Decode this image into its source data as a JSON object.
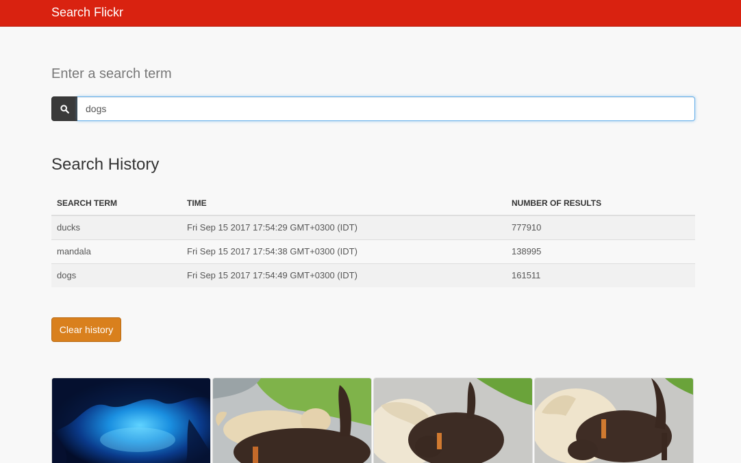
{
  "navbar": {
    "brand": "Search Flickr"
  },
  "search": {
    "prompt": "Enter a search term",
    "value": "dogs",
    "icon": "search-icon"
  },
  "history": {
    "title": "Search History",
    "columns": [
      "SEARCH TERM",
      "TIME",
      "NUMBER OF RESULTS"
    ],
    "rows": [
      {
        "term": "ducks",
        "time": "Fri Sep 15 2017 17:54:29 GMT+0300 (IDT)",
        "results": "777910"
      },
      {
        "term": "mandala",
        "time": "Fri Sep 15 2017 17:54:38 GMT+0300 (IDT)",
        "results": "138995"
      },
      {
        "term": "dogs",
        "time": "Fri Sep 15 2017 17:54:49 GMT+0300 (IDT)",
        "results": "161511"
      }
    ],
    "clear_label": "Clear history"
  },
  "colors": {
    "navbar": "#d92210",
    "clear_button": "#d9801d",
    "search_addon": "#3a3a3a"
  }
}
